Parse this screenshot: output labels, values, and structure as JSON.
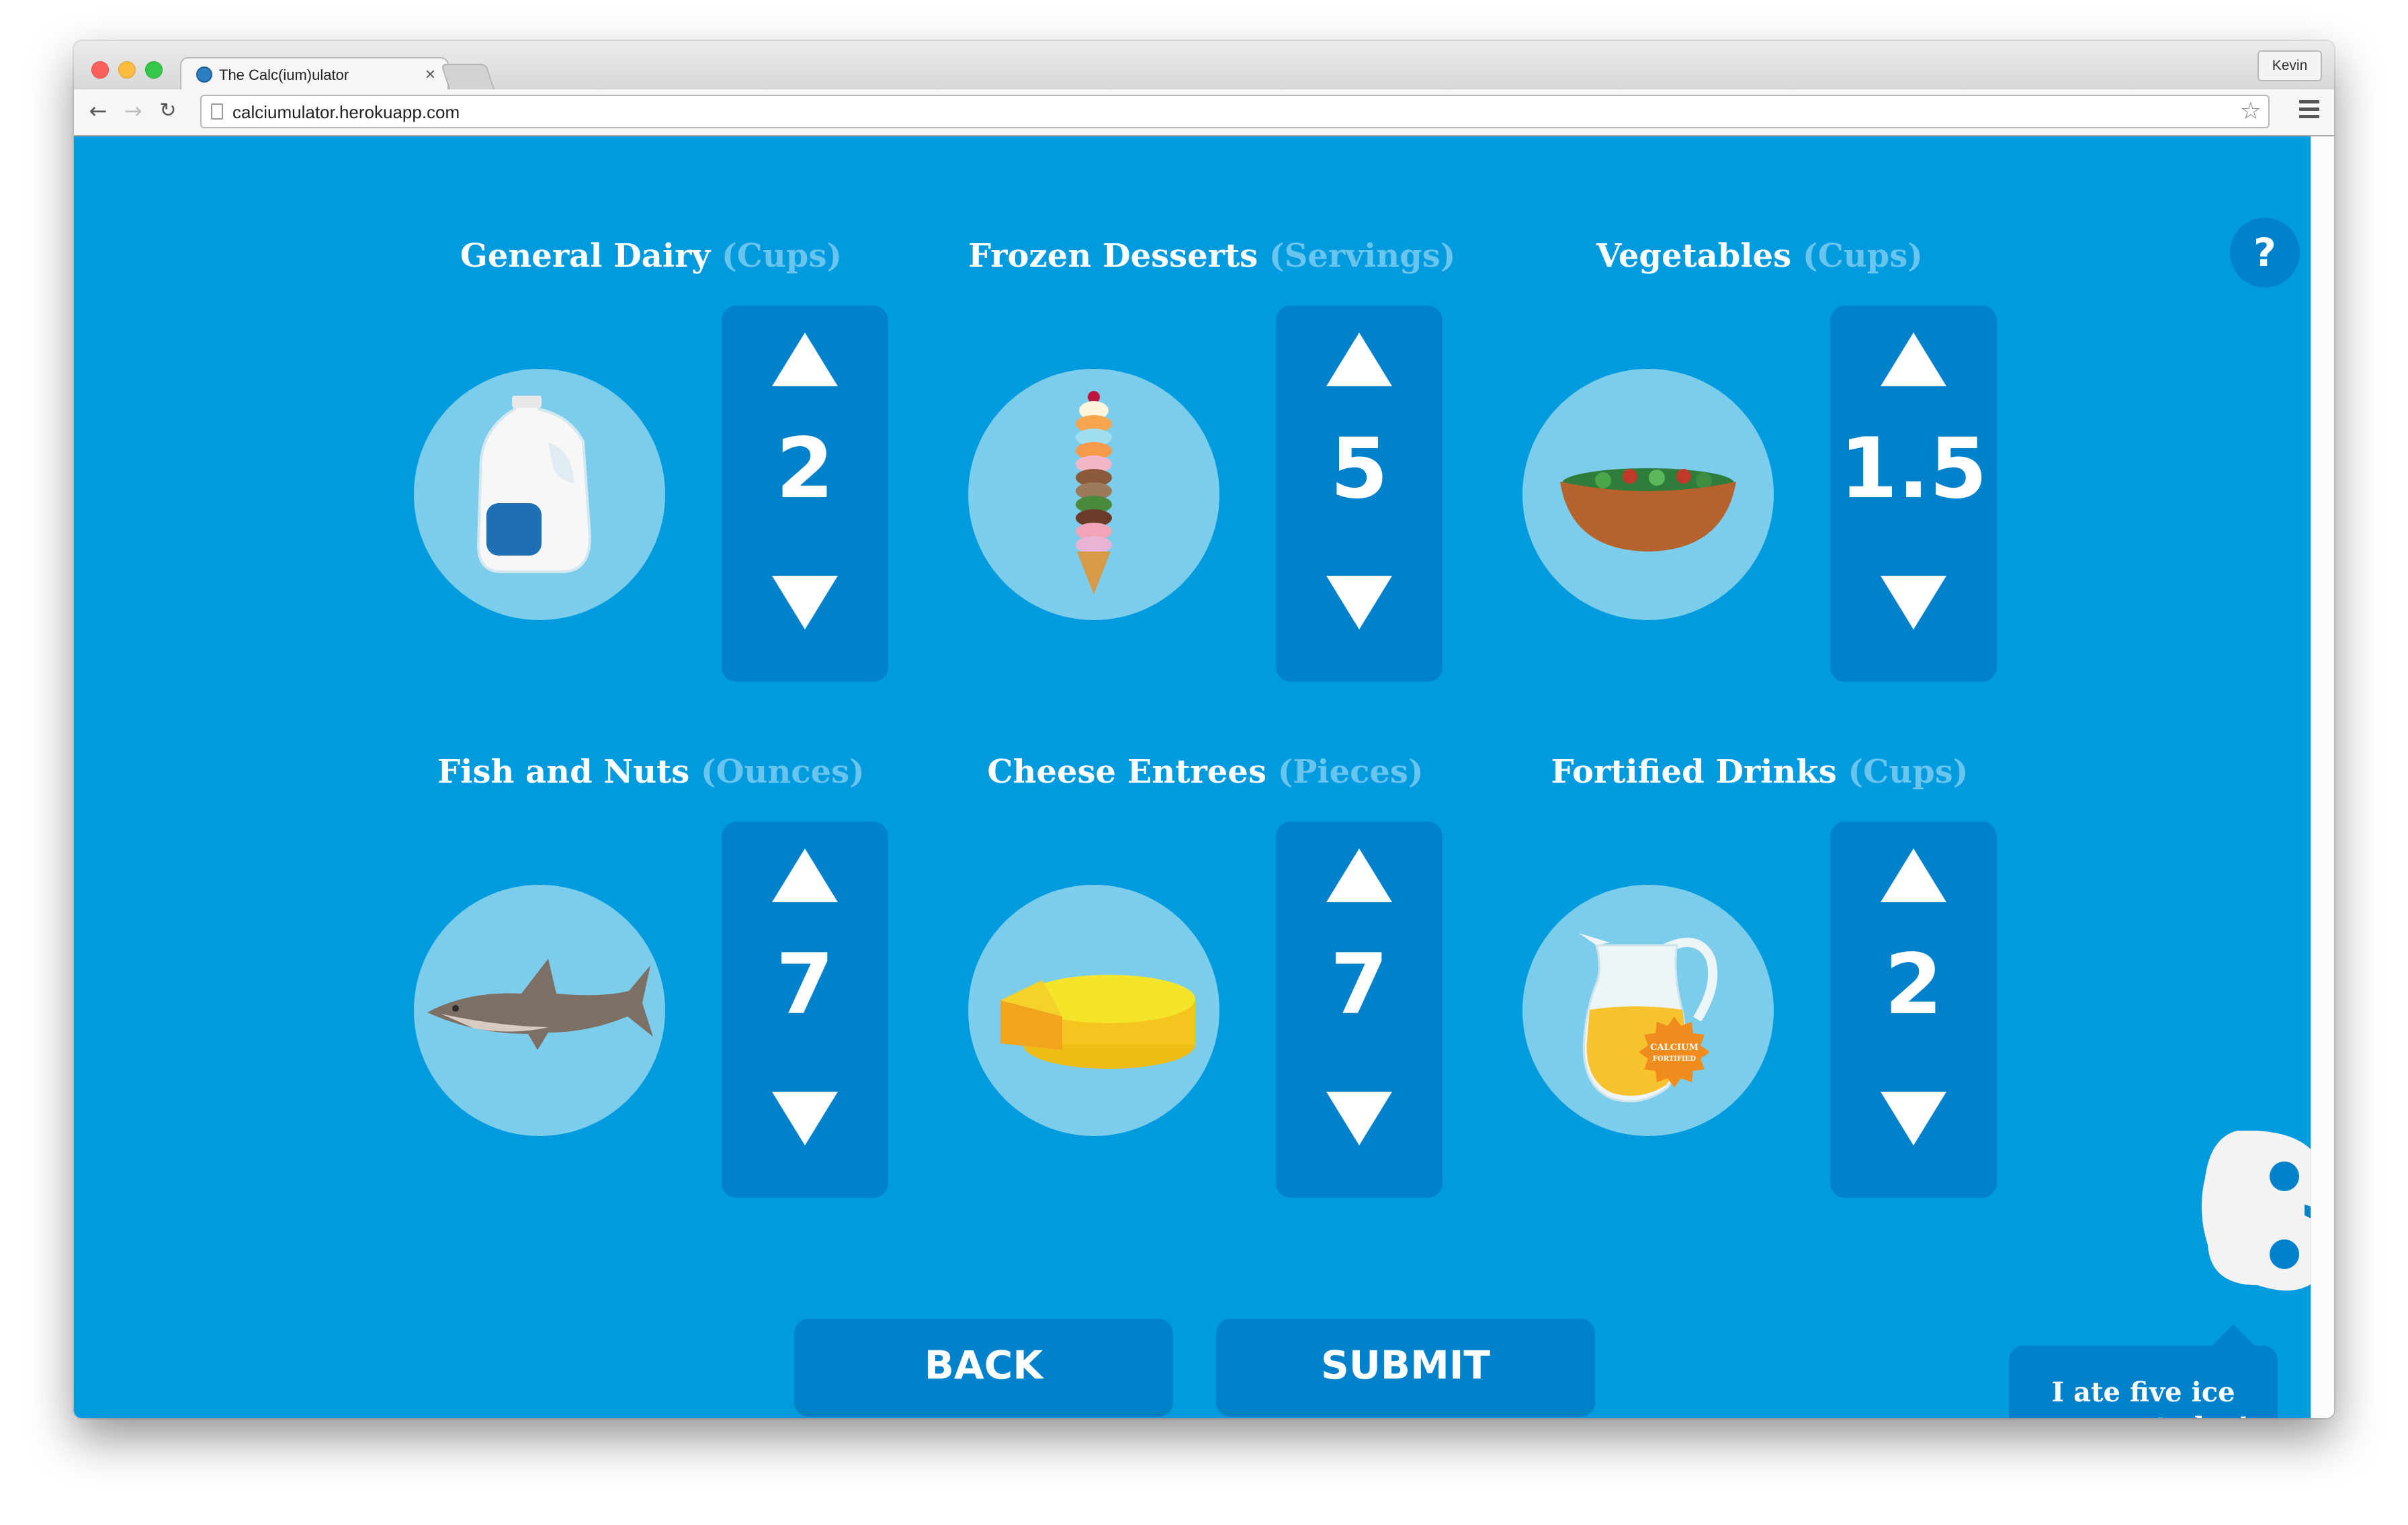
{
  "browser": {
    "tab_title": "The Calc(ium)ulator",
    "tab_close": "×",
    "profile_name": "Kevin",
    "url": "calciumulator.herokuapp.com"
  },
  "icons": {
    "help": "?",
    "back": "back-arrow-icon",
    "forward": "forward-arrow-icon",
    "reload": "reload-icon",
    "star": "star-icon",
    "menu": "hamburger-menu-icon"
  },
  "colors": {
    "page_background": "#009bdf",
    "button_background": "#0081cc",
    "circle_background": "#7bcdeb",
    "unit_text": "#69c4ee"
  },
  "categories": [
    {
      "name": "General Dairy",
      "unit": "(Cups)",
      "value": "2",
      "image": "milk-jug-icon"
    },
    {
      "name": "Frozen Desserts",
      "unit": "(Servings)",
      "value": "5",
      "image": "ice-cream-cone-icon"
    },
    {
      "name": "Vegetables",
      "unit": "(Cups)",
      "value": "1.5",
      "image": "salad-bowl-icon"
    },
    {
      "name": "Fish and Nuts",
      "unit": "(Ounces)",
      "value": "7",
      "image": "shark-icon"
    },
    {
      "name": "Cheese Entrees",
      "unit": "(Pieces)",
      "value": "7",
      "image": "cheese-wheel-icon"
    },
    {
      "name": "Fortified Drinks",
      "unit": "(Cups)",
      "value": "2",
      "image": "orange-juice-pitcher-icon",
      "badge_text": [
        "CALCIUM",
        "FORTIFIED"
      ]
    }
  ],
  "actions": {
    "back_label": "BACK",
    "submit_label": "SUBMIT"
  },
  "speech_bubble": {
    "text_line1": "I ate five ice",
    "text_line2": "creams today!"
  }
}
